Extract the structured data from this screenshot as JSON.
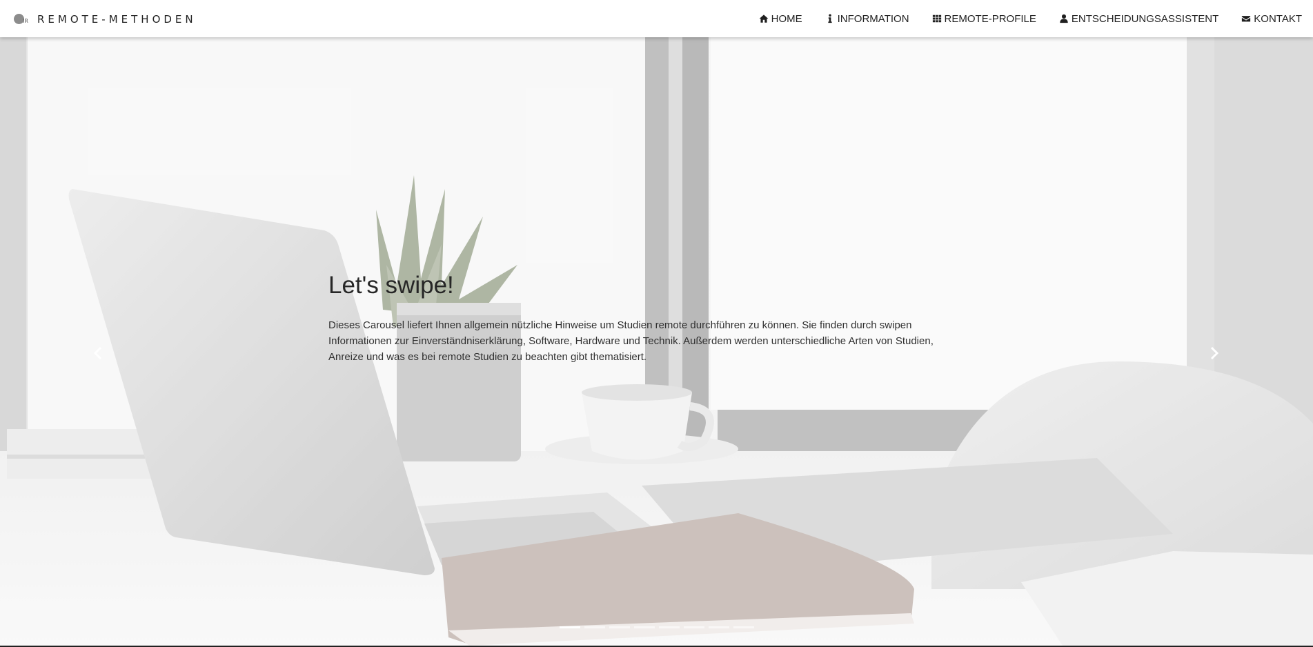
{
  "brand": {
    "name": "REMOTE-METHODEN",
    "logo_mark": "IR"
  },
  "nav": [
    {
      "label": "HOME",
      "icon": "home-icon"
    },
    {
      "label": "INFORMATION",
      "icon": "info-icon"
    },
    {
      "label": "REMOTE-PROFILE",
      "icon": "grid-icon"
    },
    {
      "label": "ENTSCHEIDUNGSASSISTENT",
      "icon": "user-icon"
    },
    {
      "label": "KONTAKT",
      "icon": "envelope-icon"
    }
  ],
  "carousel": {
    "title": "Let's swipe!",
    "text": "Dieses Carousel liefert Ihnen allgemein nützliche Hinweise um Studien remote durchführen zu können. Sie finden durch swipen Informationen zur Einverständniserklärung, Software, Hardware und Technik. Außerdem werden unterschiedliche Arten von Studien, Anreize und was es bei remote Studien zu beachten gibt thematisiert.",
    "slide_count": 8,
    "active_slide": 1
  },
  "colors": {
    "navbar_bg": "#ffffff",
    "text_dark": "#1f1f1f",
    "indicator_active": "#ffffff"
  }
}
